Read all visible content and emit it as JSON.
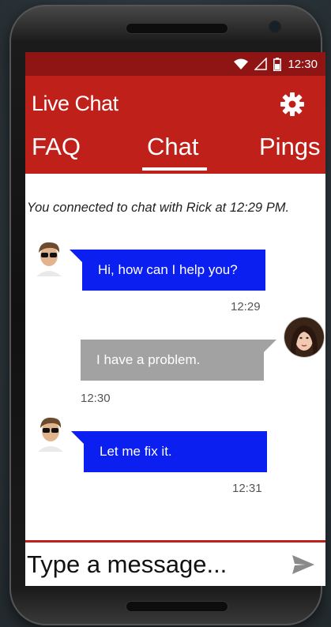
{
  "status": {
    "time": "12:30",
    "icons": [
      "wifi-icon",
      "signal-icon",
      "battery-icon"
    ]
  },
  "app": {
    "title": "Live Chat",
    "settings_icon": "gear-icon"
  },
  "tabs": [
    {
      "label": "FAQ",
      "selected": false
    },
    {
      "label": "Chat",
      "selected": true
    },
    {
      "label": "Pings",
      "selected": false
    }
  ],
  "chat": {
    "system_message": "You connected to chat with Rick at 12:29 PM.",
    "messages": [
      {
        "from": "agent",
        "text": "Hi, how can I help you?",
        "time": "12:29"
      },
      {
        "from": "user",
        "text": "I have a problem.",
        "time": "12:30"
      },
      {
        "from": "agent",
        "text": "Let me fix it.",
        "time": "12:31"
      }
    ]
  },
  "composer": {
    "placeholder": "Type a message...",
    "send_icon": "send-icon"
  },
  "colors": {
    "appbar": "#c0201a",
    "statusbar": "#8f1414",
    "agent_bubble": "#0a1ff0",
    "user_bubble": "#a2a2a2"
  }
}
